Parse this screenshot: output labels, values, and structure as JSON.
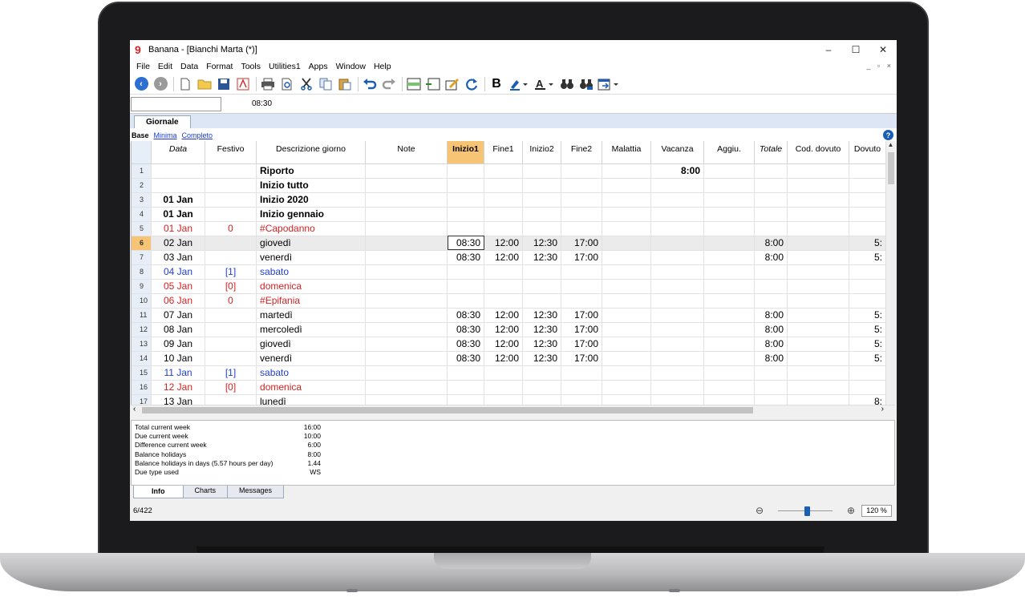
{
  "window": {
    "title": "Banana - [Bianchi Marta (*)]",
    "minimize": "–",
    "maximize": "☐",
    "close": "✕"
  },
  "menu": [
    "File",
    "Edit",
    "Data",
    "Format",
    "Tools",
    "Utilities1",
    "Apps",
    "Window",
    "Help"
  ],
  "mdi_controls": "_ ▫ ×",
  "cellbar": {
    "value": "08:30"
  },
  "doc_tab": "Giornale",
  "views": {
    "current": "Base",
    "others": [
      "Minima",
      "Completo"
    ]
  },
  "help": "?",
  "columns": [
    "Data",
    "Festivo",
    "Descrizione giorno",
    "Note",
    "Inizio1",
    "Fine1",
    "Inizio2",
    "Fine2",
    "Malattia",
    "Vacanza",
    "Aggiu.",
    "Totale",
    "Cod. dovuto",
    "Dovuto"
  ],
  "rows": [
    {
      "n": "1",
      "date": "",
      "fest": "",
      "desc": "Riporto",
      "i1": "",
      "f1": "",
      "i2": "",
      "f2": "",
      "vac": "8:00",
      "tot": "",
      "dov": "",
      "style": "bold",
      "color": ""
    },
    {
      "n": "2",
      "date": "",
      "fest": "",
      "desc": "Inizio tutto",
      "i1": "",
      "f1": "",
      "i2": "",
      "f2": "",
      "vac": "",
      "tot": "",
      "dov": "",
      "style": "bold",
      "color": ""
    },
    {
      "n": "3",
      "date": "01 Jan",
      "fest": "",
      "desc": "Inizio 2020",
      "i1": "",
      "f1": "",
      "i2": "",
      "f2": "",
      "vac": "",
      "tot": "",
      "dov": "",
      "style": "bold",
      "color": ""
    },
    {
      "n": "4",
      "date": "01 Jan",
      "fest": "",
      "desc": "Inizio gennaio",
      "i1": "",
      "f1": "",
      "i2": "",
      "f2": "",
      "vac": "",
      "tot": "",
      "dov": "",
      "style": "bold",
      "color": ""
    },
    {
      "n": "5",
      "date": "01 Jan",
      "fest": "0",
      "desc": "#Capodanno",
      "i1": "",
      "f1": "",
      "i2": "",
      "f2": "",
      "vac": "",
      "tot": "",
      "dov": "",
      "style": "",
      "color": "red"
    },
    {
      "n": "6",
      "date": "02 Jan",
      "fest": "",
      "desc": "giovedì",
      "i1": "08:30",
      "f1": "12:00",
      "i2": "12:30",
      "f2": "17:00",
      "vac": "",
      "tot": "8:00",
      "dov": "5:",
      "style": "",
      "color": ""
    },
    {
      "n": "7",
      "date": "03 Jan",
      "fest": "",
      "desc": "venerdì",
      "i1": "08:30",
      "f1": "12:00",
      "i2": "12:30",
      "f2": "17:00",
      "vac": "",
      "tot": "8:00",
      "dov": "5:",
      "style": "",
      "color": ""
    },
    {
      "n": "8",
      "date": "04 Jan",
      "fest": "[1]",
      "desc": "sabato",
      "i1": "",
      "f1": "",
      "i2": "",
      "f2": "",
      "vac": "",
      "tot": "",
      "dov": "",
      "style": "",
      "color": "blue"
    },
    {
      "n": "9",
      "date": "05 Jan",
      "fest": "[0]",
      "desc": "domenica",
      "i1": "",
      "f1": "",
      "i2": "",
      "f2": "",
      "vac": "",
      "tot": "",
      "dov": "",
      "style": "",
      "color": "red"
    },
    {
      "n": "10",
      "date": "06 Jan",
      "fest": "0",
      "desc": "#Epifania",
      "i1": "",
      "f1": "",
      "i2": "",
      "f2": "",
      "vac": "",
      "tot": "",
      "dov": "",
      "style": "",
      "color": "red"
    },
    {
      "n": "11",
      "date": "07 Jan",
      "fest": "",
      "desc": "martedì",
      "i1": "08:30",
      "f1": "12:00",
      "i2": "12:30",
      "f2": "17:00",
      "vac": "",
      "tot": "8:00",
      "dov": "5:",
      "style": "",
      "color": ""
    },
    {
      "n": "12",
      "date": "08 Jan",
      "fest": "",
      "desc": "mercoledì",
      "i1": "08:30",
      "f1": "12:00",
      "i2": "12:30",
      "f2": "17:00",
      "vac": "",
      "tot": "8:00",
      "dov": "5:",
      "style": "",
      "color": ""
    },
    {
      "n": "13",
      "date": "09 Jan",
      "fest": "",
      "desc": "giovedì",
      "i1": "08:30",
      "f1": "12:00",
      "i2": "12:30",
      "f2": "17:00",
      "vac": "",
      "tot": "8:00",
      "dov": "5:",
      "style": "",
      "color": ""
    },
    {
      "n": "14",
      "date": "10 Jan",
      "fest": "",
      "desc": "venerdì",
      "i1": "08:30",
      "f1": "12:00",
      "i2": "12:30",
      "f2": "17:00",
      "vac": "",
      "tot": "8:00",
      "dov": "5:",
      "style": "",
      "color": ""
    },
    {
      "n": "15",
      "date": "11 Jan",
      "fest": "[1]",
      "desc": "sabato",
      "i1": "",
      "f1": "",
      "i2": "",
      "f2": "",
      "vac": "",
      "tot": "",
      "dov": "",
      "style": "",
      "color": "blue"
    },
    {
      "n": "16",
      "date": "12 Jan",
      "fest": "[0]",
      "desc": "domenica",
      "i1": "",
      "f1": "",
      "i2": "",
      "f2": "",
      "vac": "",
      "tot": "",
      "dov": "",
      "style": "",
      "color": "red"
    },
    {
      "n": "17",
      "date": "13 Jan",
      "fest": "",
      "desc": "lunedì",
      "i1": "",
      "f1": "",
      "i2": "",
      "f2": "",
      "vac": "",
      "tot": "",
      "dov": "8:",
      "style": "",
      "color": ""
    }
  ],
  "selected_row": "6",
  "info": [
    {
      "label": "Total current week",
      "value": "16:00"
    },
    {
      "label": "Due current week",
      "value": "10:00"
    },
    {
      "label": "Difference current week",
      "value": "6:00"
    },
    {
      "label": "Balance holidays",
      "value": "8:00"
    },
    {
      "label": "Balance holidays in days (5.57 hours per day)",
      "value": "1.44"
    },
    {
      "label": "Due type used",
      "value": "WS"
    }
  ],
  "bottom_tabs": [
    "Info",
    "Charts",
    "Messages"
  ],
  "status": {
    "position": "6/422",
    "zoom": "120 %",
    "zoom_level_percent": 120
  },
  "colors": {
    "active_header": "#f6c474",
    "holiday_red": "#d92020",
    "weekend_blue": "#1f3ed6",
    "accent": "#1a5fb4"
  }
}
